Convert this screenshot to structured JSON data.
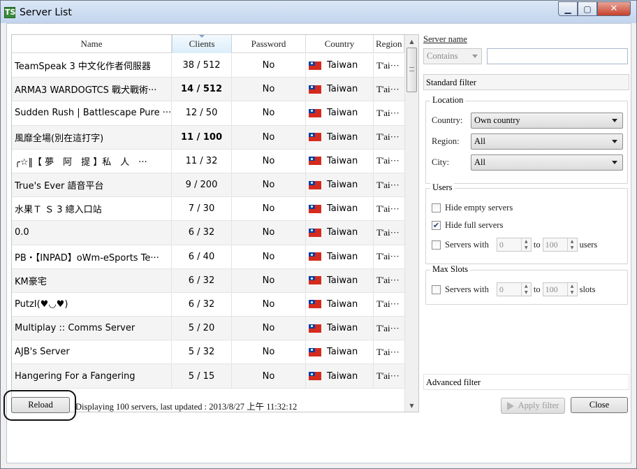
{
  "window": {
    "title": "Server List",
    "app_icon": "TS"
  },
  "table": {
    "columns": [
      "Name",
      "Clients",
      "Password",
      "Country",
      "Region"
    ],
    "rows": [
      {
        "name": "TeamSpeak 3 中文化作者伺服器",
        "clients": "38 / 512",
        "password": "No",
        "country": "Taiwan",
        "region": "T'ai···"
      },
      {
        "name": "ARMA3 WARDOGTCS 戰犬戰術···",
        "clients": "14 / 512",
        "password": "No",
        "country": "Taiwan",
        "region": "T'ai···"
      },
      {
        "name": "Sudden Rush | Battlescape Pure ···",
        "clients": "12 / 50",
        "password": "No",
        "country": "Taiwan",
        "region": "T'ai···"
      },
      {
        "name": "風靡全場(別在這打字)",
        "clients": "11 / 100",
        "password": "No",
        "country": "Taiwan",
        "region": "T'ai···"
      },
      {
        "name": "╭☆‖【 夢　阿　提 】私　人　···",
        "clients": "11 / 32",
        "password": "No",
        "country": "Taiwan",
        "region": "T'ai···"
      },
      {
        "name": "True's Ever 語音平台",
        "clients": "9 / 200",
        "password": "No",
        "country": "Taiwan",
        "region": "T'ai···"
      },
      {
        "name": "水果Ｔ Ｓ 3 總入口站",
        "clients": "7 / 30",
        "password": "No",
        "country": "Taiwan",
        "region": "T'ai···"
      },
      {
        "name": "0.0",
        "clients": "6 / 32",
        "password": "No",
        "country": "Taiwan",
        "region": "T'ai···"
      },
      {
        "name": "PB・【INPAD】oWm-eSports Te···",
        "clients": "6 / 40",
        "password": "No",
        "country": "Taiwan",
        "region": "T'ai···"
      },
      {
        "name": "KM豪宅",
        "clients": "6 / 32",
        "password": "No",
        "country": "Taiwan",
        "region": "T'ai···"
      },
      {
        "name": "PutzI(♥◡♥)",
        "clients": "6 / 32",
        "password": "No",
        "country": "Taiwan",
        "region": "T'ai···"
      },
      {
        "name": "Multiplay :: Comms Server",
        "clients": "5 / 20",
        "password": "No",
        "country": "Taiwan",
        "region": "T'ai···"
      },
      {
        "name": "AJB's Server",
        "clients": "5 / 32",
        "password": "No",
        "country": "Taiwan",
        "region": "T'ai···"
      },
      {
        "name": "Hangering For a Fangering",
        "clients": "5 / 15",
        "password": "No",
        "country": "Taiwan",
        "region": "T'ai···"
      }
    ]
  },
  "filter": {
    "server_name_label": "Server name",
    "match_mode": "Contains",
    "search_value": "",
    "standard_filter": "Standard filter",
    "location": {
      "title": "Location",
      "country_label": "Country:",
      "country_value": "Own country",
      "region_label": "Region:",
      "region_value": "All",
      "city_label": "City:",
      "city_value": "All"
    },
    "users": {
      "title": "Users",
      "hide_empty": "Hide empty servers",
      "hide_full": "Hide full servers",
      "servers_with": "Servers with",
      "min": "0",
      "to": "to",
      "max": "100",
      "unit": "users"
    },
    "max_slots": {
      "title": "Max Slots",
      "servers_with": "Servers with",
      "min": "0",
      "to": "to",
      "max": "100",
      "unit": "slots"
    },
    "advanced_filter": "Advanced filter"
  },
  "footer": {
    "reload": "Reload",
    "status": "Displaying 100 servers, last updated : 2013/8/27 上午 11:32:12",
    "apply": "Apply filter",
    "close": "Close"
  },
  "colors": {
    "accent_header": "#dceefa",
    "flag_red": "#d52b1e",
    "flag_blue": "#0c3f9c"
  }
}
